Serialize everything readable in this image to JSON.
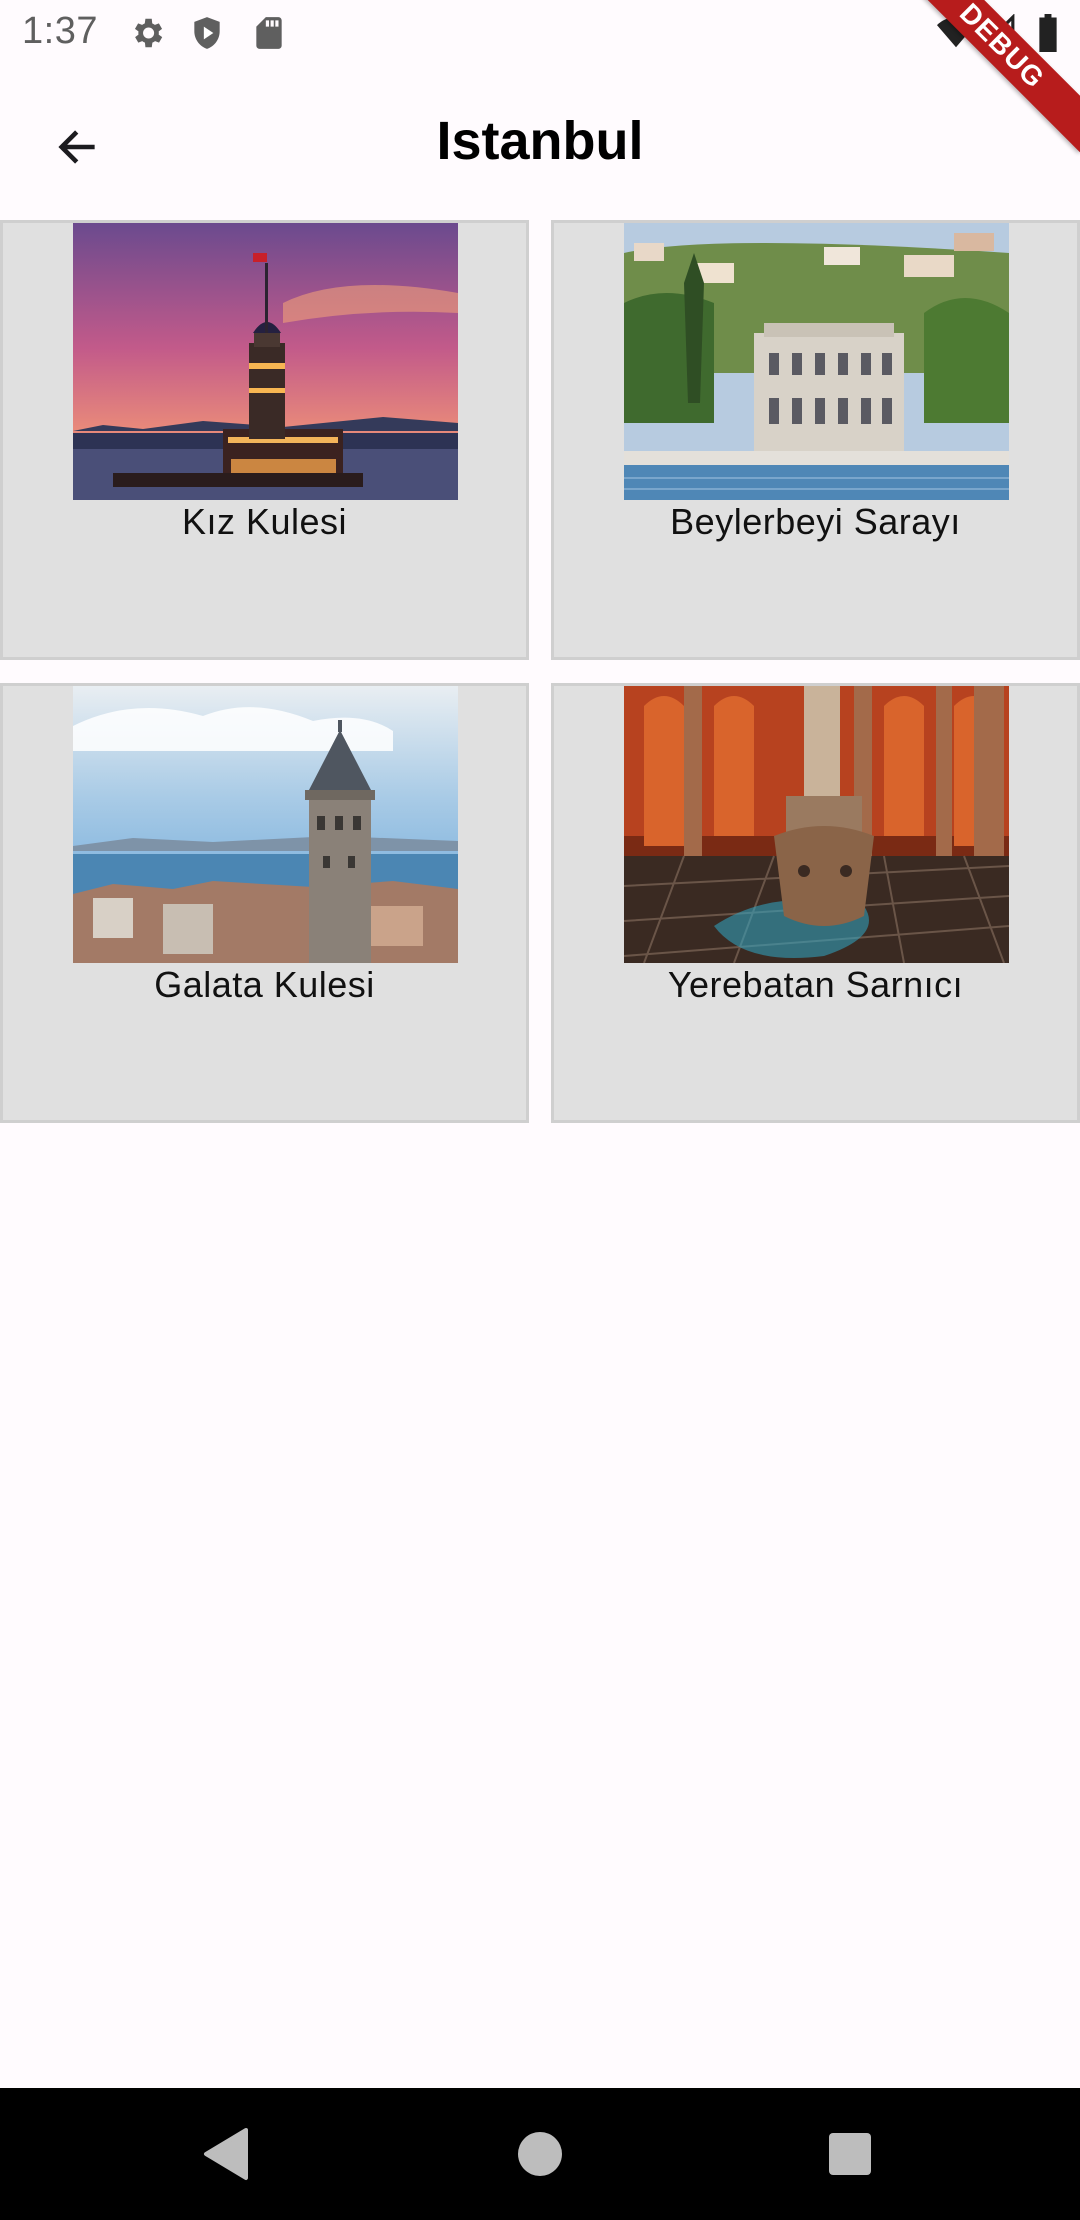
{
  "status_bar": {
    "time": "1:37",
    "icons": [
      "gear-icon",
      "shield-play-icon",
      "sd-card-icon",
      "wifi-icon",
      "signal-icon",
      "battery-icon"
    ]
  },
  "debug_banner": {
    "label": "DEBUG",
    "color": "#b71c1c"
  },
  "app_bar": {
    "title": "Istanbul",
    "back_icon": "arrow-back-icon"
  },
  "places": [
    {
      "name": "Kız Kulesi",
      "image": "maidens-tower-sunset"
    },
    {
      "name": "Beylerbeyi Sarayı",
      "image": "beylerbeyi-palace"
    },
    {
      "name": "Galata Kulesi",
      "image": "galata-tower"
    },
    {
      "name": "Yerebatan Sarnıcı",
      "image": "basilica-cistern"
    }
  ],
  "nav_bar": {
    "buttons": [
      "back-triangle-icon",
      "home-circle-icon",
      "recents-square-icon"
    ]
  },
  "colors": {
    "card_bg": "#e0e0e0",
    "card_border": "#cfcfcf",
    "page_bg": "#fffbfe",
    "nav_bg": "#000000"
  }
}
